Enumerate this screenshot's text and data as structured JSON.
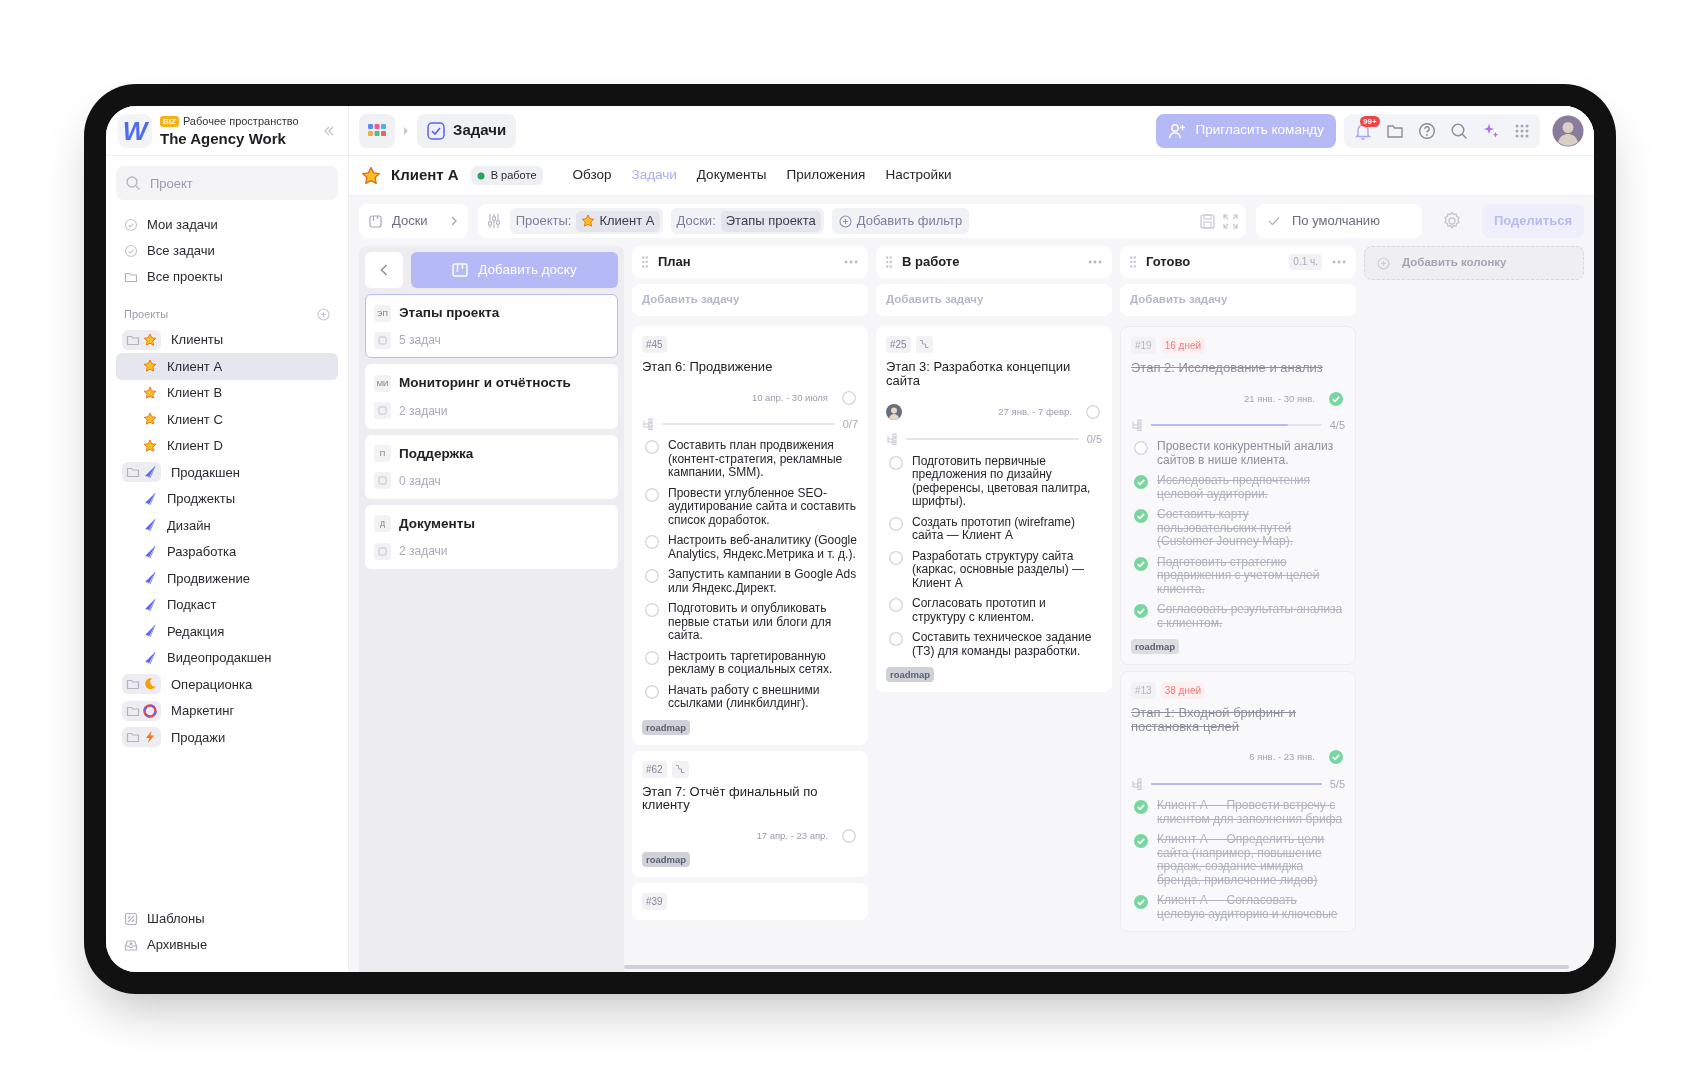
{
  "workspace": {
    "logo": "W",
    "badge": "BIZ",
    "label": "Рабочее пространство",
    "name": "The Agency Work"
  },
  "sidebar": {
    "search_placeholder": "Проект",
    "nav": [
      {
        "label": "Мои задачи"
      },
      {
        "label": "Все задачи"
      },
      {
        "label": "Все проекты"
      }
    ],
    "section_title": "Проекты",
    "projects": [
      {
        "label": "Клиенты",
        "selected": false,
        "children": [
          {
            "label": "Клиент А",
            "selected": true
          },
          {
            "label": "Клиент B",
            "selected": false
          },
          {
            "label": "Клиент C",
            "selected": false
          },
          {
            "label": "Клиент D",
            "selected": false
          }
        ]
      },
      {
        "label": "Продакшен",
        "selected": false,
        "children": [
          {
            "label": "Проджекты",
            "selected": false
          },
          {
            "label": "Дизайн",
            "selected": false
          },
          {
            "label": "Разработка",
            "selected": false
          },
          {
            "label": "Продвижение",
            "selected": false
          },
          {
            "label": "Подкаст",
            "selected": false
          },
          {
            "label": "Редакция",
            "selected": false
          },
          {
            "label": "Видеопродакшен",
            "selected": false
          }
        ]
      },
      {
        "label": "Операционка",
        "selected": false
      },
      {
        "label": "Маркетинг",
        "selected": false
      },
      {
        "label": "Продажи",
        "selected": false
      }
    ],
    "footer": [
      {
        "label": "Шаблоны"
      },
      {
        "label": "Архивные"
      }
    ]
  },
  "topbar": {
    "page": "Задачи",
    "invite_button": "Пригласить команду",
    "notification_count": "99+"
  },
  "project": {
    "name": "Клиент А",
    "status": "В работе",
    "tabs": [
      {
        "label": "Обзор",
        "selected": false
      },
      {
        "label": "Задачи",
        "selected": true
      },
      {
        "label": "Документы",
        "selected": false
      },
      {
        "label": "Приложения",
        "selected": false
      },
      {
        "label": "Настройки",
        "selected": false
      }
    ]
  },
  "toolbar": {
    "boards_button": "Доски",
    "filters": [
      {
        "label": "Проекты:",
        "value": "Клиент А"
      },
      {
        "label": "Доски:",
        "value": "Этапы проекта"
      }
    ],
    "add_filter": "Добавить фильтр",
    "view": "По умолчанию",
    "share": "Поделиться"
  },
  "boards": {
    "add_button": "Добавить доску",
    "items": [
      {
        "abbr": "ЭП",
        "name": "Этапы проекта",
        "count": "5 задач",
        "selected": true
      },
      {
        "abbr": "МИ",
        "name": "Мониторинг и отчётность",
        "count": "2 задачи",
        "selected": false
      },
      {
        "abbr": "П",
        "name": "Поддержка",
        "count": "0 задач",
        "selected": false
      },
      {
        "abbr": "Д",
        "name": "Документы",
        "count": "2 задачи",
        "selected": false
      }
    ]
  },
  "columns": [
    {
      "title": "План",
      "add_task": "Добавить задачу",
      "cards": [
        {
          "id": "#45",
          "linked": false,
          "title": "Этап 6: Продвижение",
          "assignee": false,
          "dates": "10 апр. - 30 июля",
          "done": false,
          "progress": "0/7",
          "level": 0,
          "subtasks": [
            {
              "text": "Составить план продвижения (контент-стратегия, рекламные кампании, SMM).",
              "checked": false
            },
            {
              "text": "Провести углубленное SEO-аудитирование сайта и составить список доработок.",
              "checked": false
            },
            {
              "text": "Настроить веб-аналитику (Google Analytics, Яндекс.Метрика и т. д.).",
              "checked": false
            },
            {
              "text": "Запустить кампании в Google Ads или Яндекс.Директ.",
              "checked": false
            },
            {
              "text": "Подготовить и опубликовать первые статьи или блоги для сайта.",
              "checked": false
            },
            {
              "text": "Настроить таргетированную рекламу в социальных сетях.",
              "checked": false
            },
            {
              "text": "Начать работу с внешними ссылками (линкбилдинг).",
              "checked": false
            }
          ],
          "tag": "roadmap"
        },
        {
          "id": "#62",
          "linked": true,
          "title": "Этап 7: Отчёт финальный по клиенту",
          "assignee": false,
          "dates": "17 апр. - 23 апр.",
          "done": false,
          "tag": "roadmap"
        },
        {
          "id": "#39",
          "linked": false
        }
      ]
    },
    {
      "title": "В работе",
      "add_task": "Добавить задачу",
      "cards": [
        {
          "id": "#25",
          "linked": true,
          "title": "Этап 3: Разработка концепции сайта",
          "assignee": true,
          "dates": "27 янв. - 7 февр.",
          "done": false,
          "progress": "0/5",
          "level": 0,
          "subtasks": [
            {
              "text": "Подготовить первичные предложения по дизайну (референсы, цветовая палитра, шрифты).",
              "checked": false
            },
            {
              "text": "Создать прототип (wireframe) сайта — Клиент А",
              "checked": false
            },
            {
              "text": "Разработать структуру сайта (каркас, основные разделы) — Клиент А",
              "checked": false
            },
            {
              "text": "Согласовать прототип и структуру с клиентом.",
              "checked": false
            },
            {
              "text": "Составить техническое задание (ТЗ) для команды разработки.",
              "checked": false
            }
          ],
          "tag": "roadmap"
        }
      ]
    },
    {
      "title": "Готово",
      "time": "0.1 ч.",
      "add_task": "Добавить задачу",
      "cards": [
        {
          "id": "#19",
          "overdue": "16 дней",
          "linked": false,
          "title": "Этап 2: Исследование и анализ",
          "assignee": false,
          "dates": "21 янв. - 30 янв.",
          "done": true,
          "progress": "4/5",
          "level": 0.8,
          "subtasks": [
            {
              "text": "Провести конкурентный анализ сайтов в нише клиента.",
              "checked": false
            },
            {
              "text": "Исследовать предпочтения целевой аудитории.",
              "checked": true
            },
            {
              "text": "Составить карту пользовательских путей (Customer Journey Map).",
              "checked": true
            },
            {
              "text": "Подготовить стратегию продвижения с учетом целей клиента.",
              "checked": true
            },
            {
              "text": "Согласовать результаты анализа с клиентом.",
              "checked": true
            }
          ],
          "tag": "roadmap"
        },
        {
          "id": "#13",
          "overdue": "38 дней",
          "linked": false,
          "title": "Этап 1: Входной брифинг и постановка целей",
          "assignee": false,
          "dates": "6 янв. - 23 янв.",
          "done": true,
          "progress": "5/5",
          "level": 1,
          "subtasks": [
            {
              "text": "Клиент А — Провести встречу с клиентом для заполнения брифа",
              "checked": true
            },
            {
              "text": "Клиент А — Определить цели сайта (например, повышение продаж, создание имиджа бренда, привлечение лидов)",
              "checked": true
            },
            {
              "text": "Клиент А — Согласовать целевую аудиторию и ключевые",
              "checked": true
            }
          ]
        }
      ]
    }
  ],
  "add_column": "Добавить колонку"
}
